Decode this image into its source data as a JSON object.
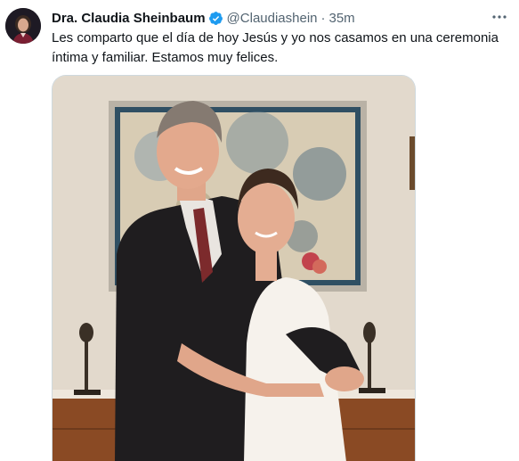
{
  "tweet": {
    "author_name": "Dra. Claudia Sheinbaum",
    "handle": "@Claudiashein",
    "separator": "·",
    "time": "35m",
    "text": "Les comparto que el día de hoy Jesús y yo nos casamos en una ceremonia\níntima y familiar. Estamos muy felices.",
    "verified": true
  },
  "icons": {
    "verified": "verified-badge-icon",
    "more": "more-options-icon"
  },
  "colors": {
    "verified": "#1d9bf0",
    "secondary_text": "#536471",
    "primary_text": "#0f1419"
  }
}
